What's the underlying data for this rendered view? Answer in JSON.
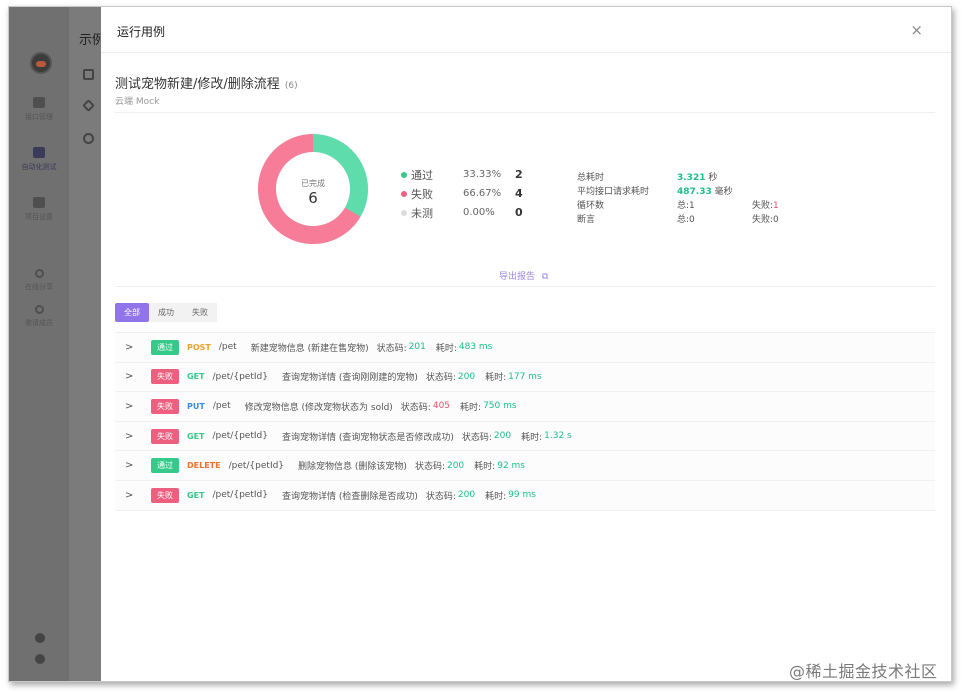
{
  "app": {
    "title": "示例",
    "sidebar": [
      {
        "label": "接口管理"
      },
      {
        "label": "自动化测试"
      },
      {
        "label": "项目设置"
      },
      {
        "label": "在线分享"
      },
      {
        "label": "邀请成员"
      }
    ]
  },
  "modal": {
    "title": "运行用例",
    "close": "×"
  },
  "case": {
    "title": "测试宠物新建/修改/删除流程",
    "count": "(6)",
    "env": "云端 Mock"
  },
  "donut": {
    "label": "已完成",
    "value": "6",
    "colors": {
      "pass": "#5fdcab",
      "fail": "#f67c97",
      "untested": "#dddddd"
    },
    "pass_fraction": 0.3333,
    "fail_fraction": 0.6667
  },
  "legend": [
    {
      "name": "通过",
      "pct": "33.33%",
      "count": "2",
      "color": "#35c98a"
    },
    {
      "name": "失败",
      "pct": "66.67%",
      "count": "4",
      "color": "#ee5e7f"
    },
    {
      "name": "未测",
      "pct": "0.00%",
      "count": "0",
      "color": "#dddddd"
    }
  ],
  "metrics": {
    "total_time_label": "总耗时",
    "total_time_value": "3.321",
    "total_time_unit": "秒",
    "avg_label": "平均接口请求耗时",
    "avg_value": "487.33",
    "avg_unit": "毫秒",
    "loop_label": "循环数",
    "loop_total": "总:1",
    "loop_fail_label": "失败:",
    "loop_fail_value": "1",
    "break_label": "断言",
    "break_total": "总:0",
    "break_fail": "失败:0"
  },
  "export_label": "导出报告",
  "filters": [
    "全部",
    "成功",
    "失败"
  ],
  "status_label": "状态码:",
  "time_label": "耗时:",
  "rows": [
    {
      "status": "通过",
      "type": "pass",
      "method": "POST",
      "method_color": "#f0a030",
      "path": "/pet",
      "desc": "新建宠物信息 (新建在售宠物)",
      "code": "201",
      "code_type": "ok",
      "time": "483 ms"
    },
    {
      "status": "失败",
      "type": "fail",
      "method": "GET",
      "method_color": "#35c98a",
      "path": "/pet/{petId}",
      "desc": "查询宠物详情 (查询刚刚建的宠物)",
      "code": "200",
      "code_type": "ok",
      "time": "177 ms"
    },
    {
      "status": "失败",
      "type": "fail",
      "method": "PUT",
      "method_color": "#3a8ee6",
      "path": "/pet",
      "desc": "修改宠物信息 (修改宠物状态为 sold)",
      "code": "405",
      "code_type": "bad",
      "time": "750 ms"
    },
    {
      "status": "失败",
      "type": "fail",
      "method": "GET",
      "method_color": "#35c98a",
      "path": "/pet/{petId}",
      "desc": "查询宠物详情 (查询宠物状态是否修改成功)",
      "code": "200",
      "code_type": "ok",
      "time": "1.32 s"
    },
    {
      "status": "通过",
      "type": "pass",
      "method": "DELETE",
      "method_color": "#f0702a",
      "path": "/pet/{petId}",
      "desc": "删除宠物信息 (删除该宠物)",
      "code": "200",
      "code_type": "ok",
      "time": "92 ms"
    },
    {
      "status": "失败",
      "type": "fail",
      "method": "GET",
      "method_color": "#35c98a",
      "path": "/pet/{petId}",
      "desc": "查询宠物详情 (检查删除是否成功)",
      "code": "200",
      "code_type": "ok",
      "time": "99 ms"
    }
  ],
  "watermark": "@稀土掘金技术社区"
}
